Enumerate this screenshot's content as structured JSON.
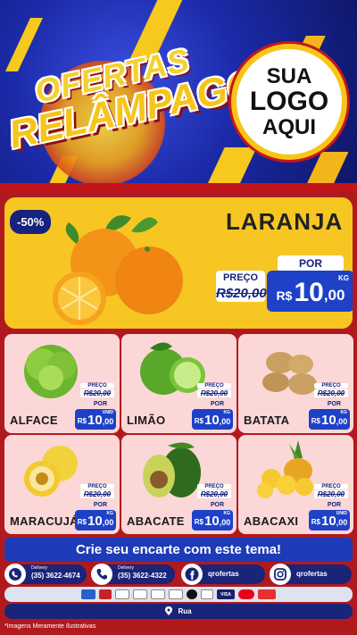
{
  "header": {
    "title_line1": "OFERTAS",
    "title_line2": "RELÂMPAGO",
    "logo_placeholder": [
      "SUA",
      "LOGO",
      "AQUI"
    ]
  },
  "featured": {
    "discount_badge": "-50%",
    "name": "LARANJA",
    "old_label": "PREÇO",
    "old_price": "R$20,00",
    "new_label": "POR",
    "currency": "R$",
    "price_int": "10",
    "price_dec": ",00",
    "unit": "KG"
  },
  "products": [
    {
      "name": "ALFACE",
      "old_label": "PREÇO",
      "old_price": "R$20,00",
      "new_label": "POR",
      "currency": "R$",
      "price_int": "10",
      "price_dec": ",00",
      "unit": "UNID"
    },
    {
      "name": "LIMÃO",
      "old_label": "PREÇO",
      "old_price": "R$20,00",
      "new_label": "POR",
      "currency": "R$",
      "price_int": "10",
      "price_dec": ",00",
      "unit": "KG"
    },
    {
      "name": "BATATA",
      "old_label": "PREÇO",
      "old_price": "R$20,00",
      "new_label": "POR",
      "currency": "R$",
      "price_int": "10",
      "price_dec": ",00",
      "unit": "KG"
    },
    {
      "name": "MARACUJÁ",
      "old_label": "PREÇO",
      "old_price": "R$20,00",
      "new_label": "POR",
      "currency": "R$",
      "price_int": "10",
      "price_dec": ",00",
      "unit": "KG"
    },
    {
      "name": "ABACATE",
      "old_label": "PREÇO",
      "old_price": "R$20,00",
      "new_label": "POR",
      "currency": "R$",
      "price_int": "10",
      "price_dec": ",00",
      "unit": "KG"
    },
    {
      "name": "ABACAXI",
      "old_label": "PREÇO",
      "old_price": "R$20,00",
      "new_label": "POR",
      "currency": "R$",
      "price_int": "10",
      "price_dec": ",00",
      "unit": "UNID"
    }
  ],
  "cta": "Crie seu encarte com este tema!",
  "contacts": {
    "whatsapp": {
      "label": "Delivery",
      "value": "(35) 3622-4674"
    },
    "phone": {
      "label": "Delivery",
      "value": "(35) 3622-4322"
    },
    "facebook": {
      "value": "qrofertas"
    },
    "instagram": {
      "value": "qrofertas"
    }
  },
  "payments": [
    "VISA"
  ],
  "address": "Rua",
  "footnote": "*Imagens Meramente Ilustrativas",
  "colors": {
    "header_blue": "#1b2aa8",
    "accent_yellow": "#f7c622",
    "brand_red": "#b01a1f",
    "price_blue": "#1e41c8",
    "card_pink": "#fbd7d7"
  }
}
